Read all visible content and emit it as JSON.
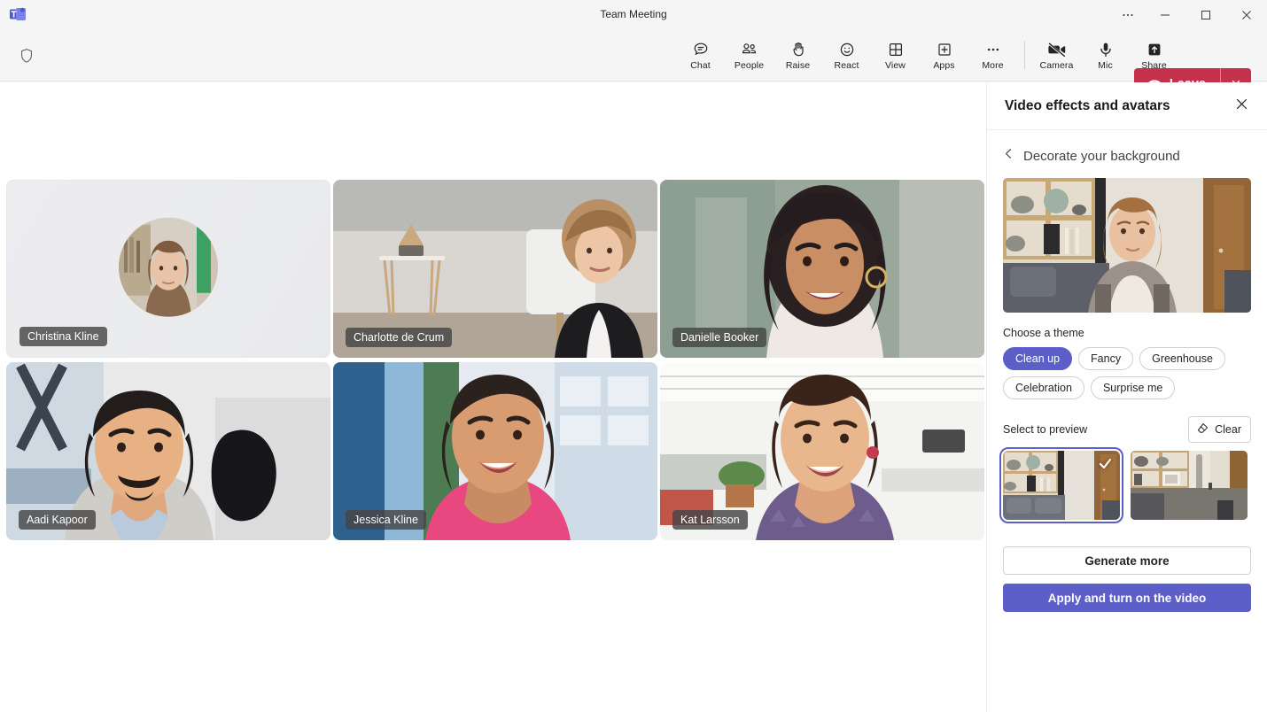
{
  "window": {
    "title": "Team Meeting",
    "logo_icon": "teams-logo-icon",
    "more_icon": "ellipsis-icon",
    "minimize_icon": "minimize-icon",
    "maximize_icon": "maximize-icon",
    "close_icon": "close-icon"
  },
  "toolbar": {
    "shield_icon": "shield-icon",
    "items": [
      {
        "label": "Chat",
        "icon": "chat-icon"
      },
      {
        "label": "People",
        "icon": "people-icon"
      },
      {
        "label": "Raise",
        "icon": "raise-hand-icon"
      },
      {
        "label": "React",
        "icon": "react-smiley-icon"
      },
      {
        "label": "View",
        "icon": "view-grid-icon"
      },
      {
        "label": "Apps",
        "icon": "apps-plus-icon"
      },
      {
        "label": "More",
        "icon": "more-ellipsis-icon"
      }
    ],
    "media": [
      {
        "label": "Camera",
        "icon": "camera-off-icon"
      },
      {
        "label": "Mic",
        "icon": "microphone-icon"
      },
      {
        "label": "Share",
        "icon": "share-screen-icon"
      }
    ],
    "leave": {
      "label": "Leave",
      "icon": "hangup-phone-icon",
      "caret_icon": "chevron-down-icon",
      "color": "#C4314B"
    }
  },
  "stage": {
    "participants": [
      {
        "name": "Christina Kline",
        "video_on": false
      },
      {
        "name": "Charlotte de Crum",
        "video_on": true
      },
      {
        "name": "Danielle Booker",
        "video_on": true
      },
      {
        "name": "Aadi Kapoor",
        "video_on": true
      },
      {
        "name": "Jessica Kline",
        "video_on": true
      },
      {
        "name": "Kat Larsson",
        "video_on": true
      }
    ]
  },
  "panel": {
    "title": "Video effects and avatars",
    "close_icon": "close-icon",
    "back_icon": "chevron-left-icon",
    "back_label": "Decorate your background",
    "theme_label": "Choose a theme",
    "themes": [
      {
        "label": "Clean up",
        "selected": true
      },
      {
        "label": "Fancy",
        "selected": false
      },
      {
        "label": "Greenhouse",
        "selected": false
      },
      {
        "label": "Celebration",
        "selected": false
      },
      {
        "label": "Surprise me",
        "selected": false
      }
    ],
    "select_label": "Select to preview",
    "clear_label": "Clear",
    "clear_icon": "eraser-icon",
    "thumb_check_icon": "checkmark-icon",
    "generate_label": "Generate more",
    "apply_label": "Apply and turn on the video",
    "accent_color": "#5B5FC7"
  }
}
